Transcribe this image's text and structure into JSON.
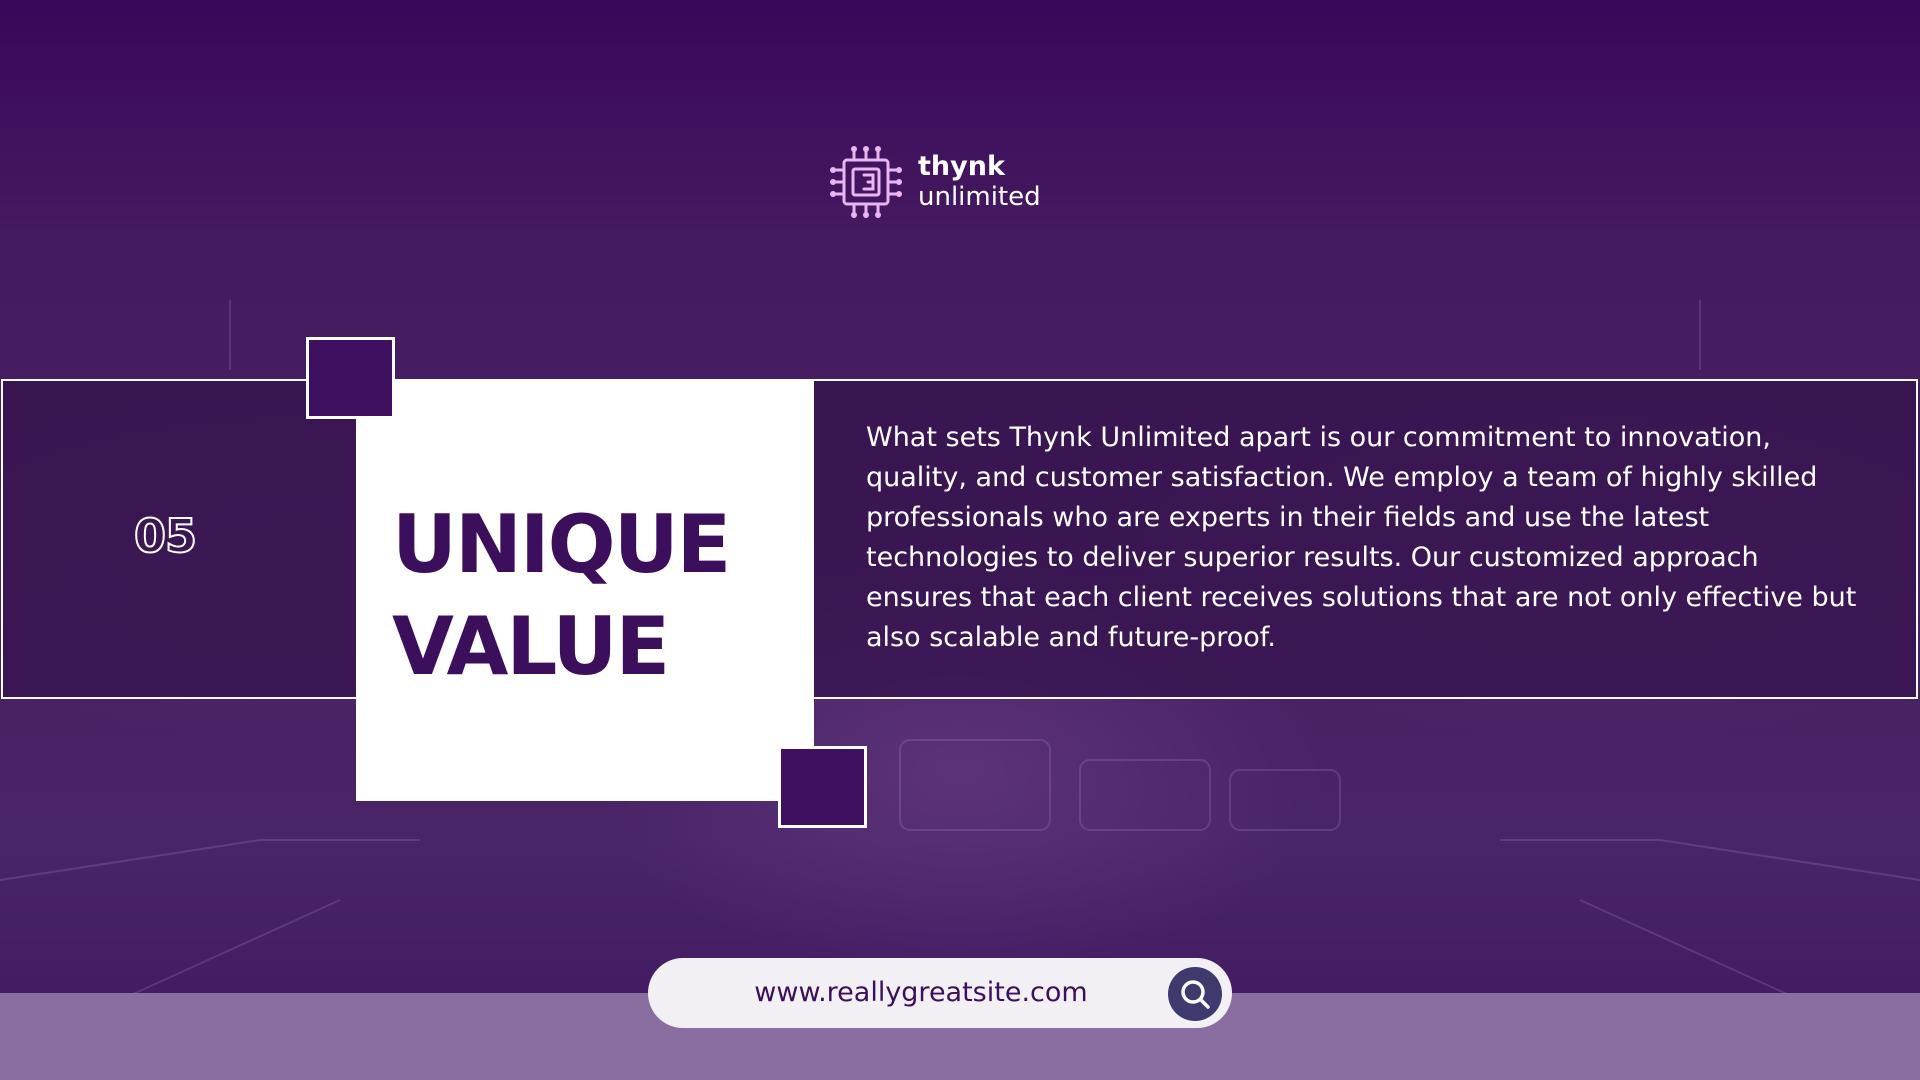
{
  "brand": {
    "name_line1": "thynk",
    "name_line2": "unlimited",
    "logo_icon": "microchip-icon"
  },
  "section": {
    "number": "05",
    "title_line1": "UNIQUE",
    "title_line2": "VALUE",
    "description": "What sets Thynk Unlimited apart is our commitment to innovation, quality, and customer satisfaction. We employ a team of highly skilled professionals who are experts in their fields and use the latest technologies to deliver superior results. Our customized approach ensures that each client receives solutions that are not only effective but also scalable and future-proof."
  },
  "search": {
    "url": "www.reallygreatsite.com",
    "icon": "search-icon"
  },
  "colors": {
    "background": "#441a60",
    "accent_dark": "#3c0f5c",
    "card": "#ffffff",
    "bottom_band": "#8a6ea0",
    "search_button": "#3e3a6e"
  }
}
